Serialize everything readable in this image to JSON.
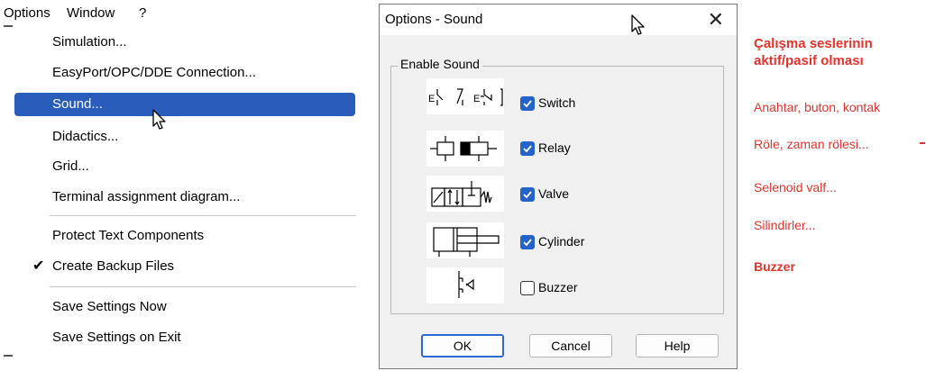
{
  "menubar": {
    "items": [
      "Options",
      "Window",
      "?"
    ]
  },
  "menu": {
    "items": [
      {
        "label": "Simulation..."
      },
      {
        "label": "EasyPort/OPC/DDE Connection..."
      },
      {
        "label": "Sound..."
      },
      {
        "label": "Didactics..."
      },
      {
        "label": "Grid..."
      },
      {
        "label": "Terminal assignment diagram..."
      },
      {
        "label": "Protect Text Components"
      },
      {
        "label": "Create Backup Files"
      },
      {
        "label": "Save Settings Now"
      },
      {
        "label": "Save Settings on Exit"
      }
    ],
    "selected_index": 2,
    "checked_item": "Create Backup Files"
  },
  "dialog": {
    "title": "Options - Sound",
    "group_label": "Enable Sound",
    "options": [
      {
        "label": "Switch",
        "checked": true,
        "icon": "switch-symbol-icon"
      },
      {
        "label": "Relay",
        "checked": true,
        "icon": "relay-symbol-icon"
      },
      {
        "label": "Valve",
        "checked": true,
        "icon": "valve-symbol-icon"
      },
      {
        "label": "Cylinder",
        "checked": true,
        "icon": "cylinder-symbol-icon"
      },
      {
        "label": "Buzzer",
        "checked": false,
        "icon": "buzzer-symbol-icon"
      }
    ],
    "buttons": {
      "ok": "OK",
      "cancel": "Cancel",
      "help": "Help"
    }
  },
  "annotations": {
    "heading_line1": "Çalışma seslerinin",
    "heading_line2": "aktif/pasif olması",
    "items": [
      "Anahtar, buton, kontak",
      "Röle, zaman rölesi...",
      "Selenoid valf...",
      "Silindirler...",
      "Buzzer"
    ],
    "color": "#e8322b"
  },
  "colors": {
    "selection": "#2a5dbb",
    "checkbox": "#2563c9"
  }
}
